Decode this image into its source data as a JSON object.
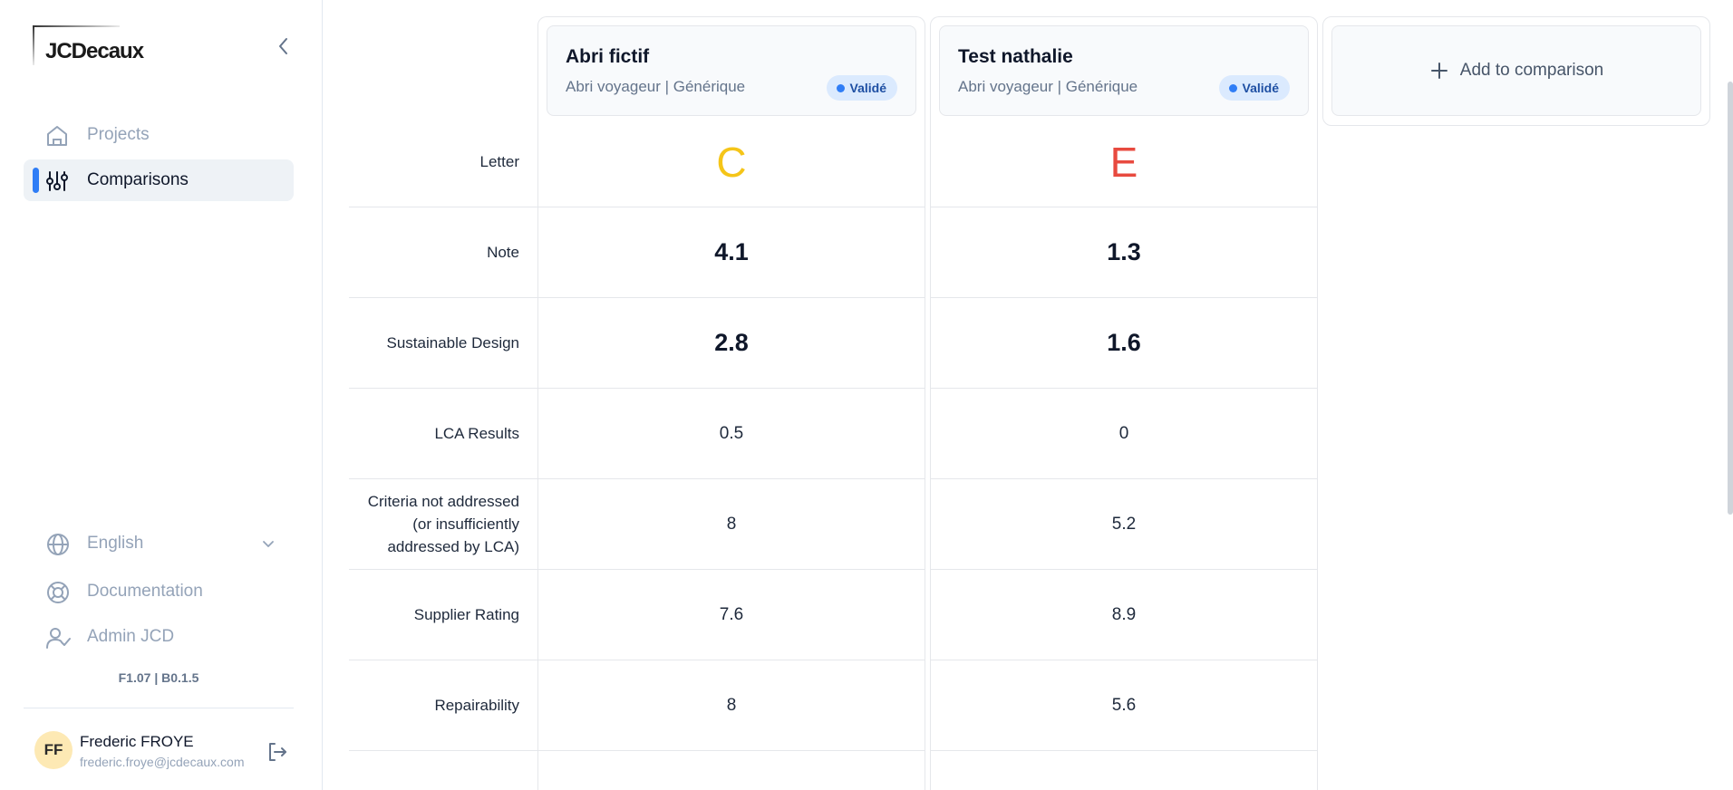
{
  "brand": {
    "logo_text": "JCDecaux"
  },
  "sidebar": {
    "nav": [
      {
        "label": "Projects"
      },
      {
        "label": "Comparisons"
      }
    ],
    "language": "English",
    "documentation": "Documentation",
    "admin": "Admin JCD",
    "version": "F1.07 | B0.1.5",
    "user": {
      "initials": "FF",
      "name": "Frederic FROYE",
      "email": "frederic.froye@jcdecaux.com"
    }
  },
  "comparison": {
    "row_labels": [
      "Letter",
      "Note",
      "Sustainable Design",
      "LCA Results",
      "Criteria not addressed (or insufficiently addressed by LCA)",
      "Supplier Rating",
      "Repairability"
    ],
    "products": [
      {
        "name": "Abri fictif",
        "subtitle": "Abri voyageur | Générique",
        "status": "Validé",
        "letter": "C",
        "letter_color": "#f5c518",
        "note": "4.1",
        "sustainable_design": "2.8",
        "lca_results": "0.5",
        "criteria_not_addressed": "8",
        "supplier_rating": "7.6",
        "repairability": "8"
      },
      {
        "name": "Test nathalie",
        "subtitle": "Abri voyageur | Générique",
        "status": "Validé",
        "letter": "E",
        "letter_color": "#e84a3f",
        "note": "1.3",
        "sustainable_design": "1.6",
        "lca_results": "0",
        "criteria_not_addressed": "5.2",
        "supplier_rating": "8.9",
        "repairability": "5.6"
      }
    ],
    "add_label": "Add to comparison"
  },
  "colors": {
    "accent": "#2f7df6",
    "badge_bg": "#dbeafe"
  }
}
